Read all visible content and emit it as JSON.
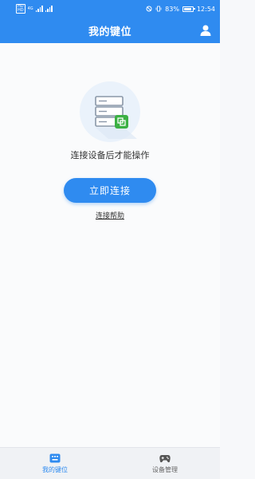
{
  "status_bar": {
    "battery": "83%",
    "time": "12:54",
    "net_label_top": "HD",
    "net_label_bottom": "HD",
    "lte": "4G"
  },
  "header": {
    "title": "我的键位"
  },
  "main": {
    "hint": "连接设备后才能操作",
    "connect_label": "立即连接",
    "help_label": "连接帮助"
  },
  "tabbar": {
    "tabs": [
      {
        "label": "我的键位",
        "active": true,
        "icon": "keyboard-icon"
      },
      {
        "label": "设备管理",
        "active": false,
        "icon": "gamepad-icon"
      }
    ]
  },
  "colors": {
    "accent": "#2f8bf0",
    "success": "#3cb043"
  }
}
